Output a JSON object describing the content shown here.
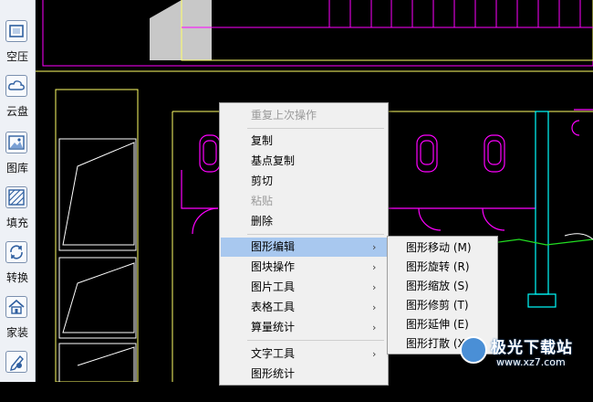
{
  "sidebar": {
    "tools": [
      {
        "label": "空压",
        "icon": "window-icon"
      },
      {
        "label": "云盘",
        "icon": "cloud-icon"
      },
      {
        "label": "图库",
        "icon": "gallery-icon"
      },
      {
        "label": "填充",
        "icon": "hatch-icon"
      },
      {
        "label": "转换",
        "icon": "convert-icon"
      },
      {
        "label": "家装",
        "icon": "house-icon"
      },
      {
        "label": "",
        "icon": "pen-icon"
      }
    ]
  },
  "context_menu": {
    "items": [
      {
        "label": "重复上次操作",
        "enabled": false
      },
      {
        "label": "复制",
        "enabled": true
      },
      {
        "label": "基点复制",
        "enabled": true
      },
      {
        "label": "剪切",
        "enabled": true
      },
      {
        "label": "粘贴",
        "enabled": false
      },
      {
        "label": "删除",
        "enabled": true
      },
      {
        "label": "图形编辑",
        "enabled": true,
        "submenu": true,
        "active": true
      },
      {
        "label": "图块操作",
        "enabled": true,
        "submenu": true
      },
      {
        "label": "图片工具",
        "enabled": true,
        "submenu": true
      },
      {
        "label": "表格工具",
        "enabled": true,
        "submenu": true
      },
      {
        "label": "算量统计",
        "enabled": true,
        "submenu": true
      },
      {
        "label": "文字工具",
        "enabled": true,
        "submenu": true
      },
      {
        "label": "图形统计",
        "enabled": true
      }
    ],
    "submenu_arrow": "›"
  },
  "submenu": {
    "items": [
      {
        "label": "图形移动 (M)"
      },
      {
        "label": "图形旋转 (R)"
      },
      {
        "label": "图形缩放 (S)"
      },
      {
        "label": "图形修剪 (T)"
      },
      {
        "label": "图形延伸 (E)"
      },
      {
        "label": "图形打散 (X)"
      }
    ]
  },
  "watermark": {
    "title": "极光下载站",
    "url": "www.xz7.com"
  },
  "colors": {
    "canvas_bg": "#000000",
    "magenta": "#ff00ff",
    "yellow": "#ffff66",
    "cyan": "#00ffff",
    "green": "#22dd22",
    "white": "#ffffff",
    "menu_highlight": "#a8c8ef"
  }
}
